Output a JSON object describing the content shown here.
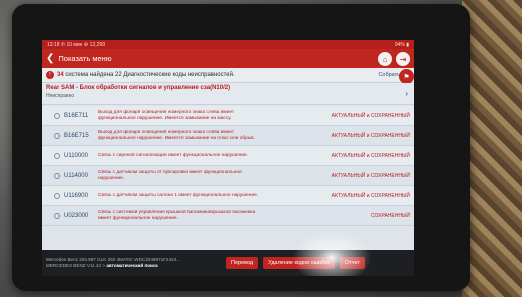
{
  "statusbar": {
    "left": "13:18 ✆ 10 мин ⚙ 12,299",
    "right": "94% ▮"
  },
  "header": {
    "title": "Показать меню"
  },
  "summary": {
    "count_systems": "34",
    "text": "система найдена 22 Диагностические коды неисправностей.",
    "collect_label": "Собрать"
  },
  "module": {
    "name": "Rear SAM - Блок обработки сигналов и управление сза(N10/2)",
    "state": "Неисправно"
  },
  "dtcs": [
    {
      "code": "B16E711",
      "desc": "Выход для фонаря освещения номерного знака слева имеет функциональное нарушение. Имеется замыкание на массу.",
      "status": "АКТУАЛЬНЫЙ и СОХРАНЕННЫЙ"
    },
    {
      "code": "B16E715",
      "desc": "Выход для фонаря освещения номерного знака слева имеет функциональное нарушение. Имеется замыкание на плюс или обрыв.",
      "status": "АКТУАЛЬНЫЙ и СОХРАНЕННЫЙ"
    },
    {
      "code": "U110000",
      "desc": "Связь с сиреной сигнализации имеет функциональное нарушение.",
      "status": "АКТУАЛЬНЫЙ и СОХРАНЕННЫЙ"
    },
    {
      "code": "U114000",
      "desc": "Связь с датчиком защиты от буксировки имеет функциональное нарушение.",
      "status": "АКТУАЛЬНЫЙ и СОХРАНЕННЫЙ"
    },
    {
      "code": "U116900",
      "desc": "Связь с датчиком защиты салона 1 имеет функциональное нарушение.",
      "status": "АКТУАЛЬНЫЙ и СОХРАНЕННЫЙ"
    },
    {
      "code": "U023000",
      "desc": "Связь с системой управления крышкой багажника/крышкой багажника имеет функциональное нарушение.",
      "status": "СОХРАНЕННЫЙ"
    }
  ],
  "footer": {
    "vehicle_line1": "Mercedes Benz 204.987 GLK 350 4MATIC WDC2049871F2424...",
    "vehicle_line2": "MERCEDES BENZ V11.24 >",
    "mode": "автоматический поиск",
    "buttons": {
      "translate": "Перевод",
      "clear": "Удаление кодов ошибок",
      "report": "Отчет"
    }
  },
  "colors": {
    "brand_red": "#c02520",
    "code_blue": "#2d4a66"
  }
}
